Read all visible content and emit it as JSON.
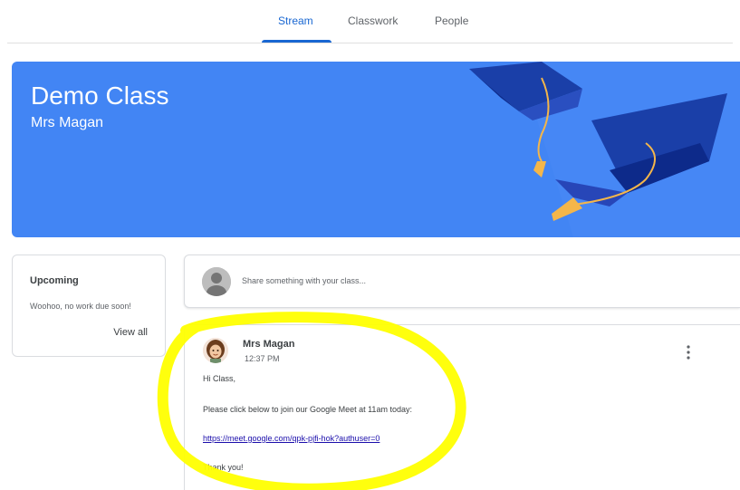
{
  "tabs": [
    {
      "label": "Stream",
      "active": true
    },
    {
      "label": "Classwork",
      "active": false
    },
    {
      "label": "People",
      "active": false
    }
  ],
  "banner": {
    "title": "Demo Class",
    "subtitle": "Mrs Magan",
    "color": "#4285f4"
  },
  "upcoming": {
    "title": "Upcoming",
    "text": "Woohoo, no work due soon!",
    "view_all": "View all"
  },
  "share": {
    "placeholder": "Share something with your class..."
  },
  "post": {
    "author": "Mrs Magan",
    "time": "12:37 PM",
    "greeting": "Hi Class,",
    "message": "Please click below to join our Google Meet at 11am today:",
    "link": "https://meet.google.com/qpk-pjfi-hok?authuser=0",
    "closing": "Thank you!"
  },
  "colors": {
    "accent": "#1967d2",
    "highlight": "#ffff00"
  }
}
